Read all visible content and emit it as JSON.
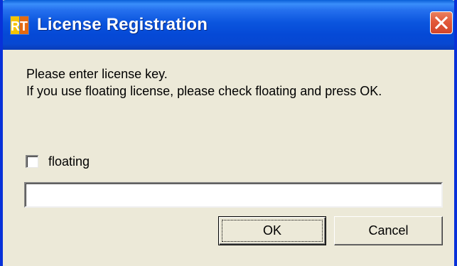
{
  "window": {
    "title": "License Registration",
    "app_icon": "rt-app-icon",
    "close_icon": "close-icon"
  },
  "dialog": {
    "message_line1": "Please enter license key.",
    "message_line2": "If you use floating license, please check floating and press OK.",
    "floating_label": "floating",
    "floating_checked": false,
    "license_key_value": "",
    "ok_label": "OK",
    "cancel_label": "Cancel"
  },
  "colors": {
    "titlebar": "#0549D6",
    "window_background": "#ECE9D8",
    "close_button": "#E2593A"
  }
}
